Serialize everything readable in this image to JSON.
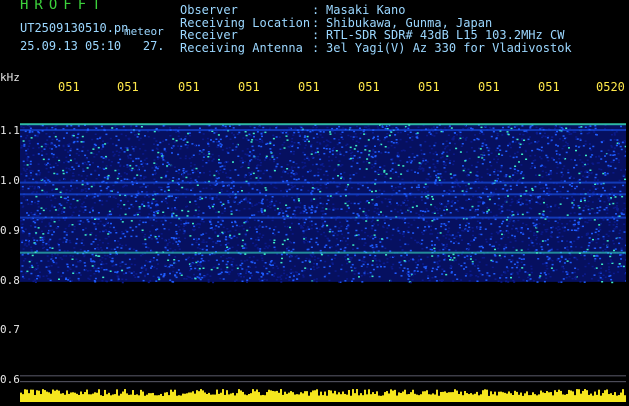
{
  "app": {
    "title": "HROFFT"
  },
  "file": {
    "name": "UT2509130510.pn",
    "suffix": "meteor",
    "datetime": "25.09.13 05:10",
    "count": "27."
  },
  "station": {
    "labels": "Observer\nReceiving Location\nReceiver\nReceiving Antenna",
    "colons": ":\n:\n:\n:",
    "values": "Masaki Kano\nShibukawa, Gunma, Japan\nRTL-SDR SDR# 43dB L15 103.2MHz CW\n3el Yagi(V) Az 330 for Vladivostok"
  },
  "axis": {
    "unit": "kHz",
    "freq_labels": [
      "1.1",
      "1.0",
      "0.9",
      "0.8",
      "0.7",
      "0.6"
    ],
    "time_labels": [
      "051",
      "051",
      "051",
      "051",
      "051",
      "051",
      "051",
      "051",
      "051",
      "0520"
    ]
  },
  "colors": {
    "title_green": "#3cd23c",
    "info_text": "#9bd7ff",
    "time_ticks": "#ffe84a",
    "signal_low": "#0a1a8c",
    "signal_mid": "#1e5cff",
    "signal_high": "#3cf0c8",
    "level_bar": "#f5e61e"
  },
  "spectrogram": {
    "freq_range_khz": [
      0.6,
      1.1
    ],
    "band_khz": [
      0.78,
      1.05
    ],
    "carrier_lines_khz": [
      1.05,
      1.04,
      0.95,
      0.93,
      0.89,
      0.83
    ]
  }
}
